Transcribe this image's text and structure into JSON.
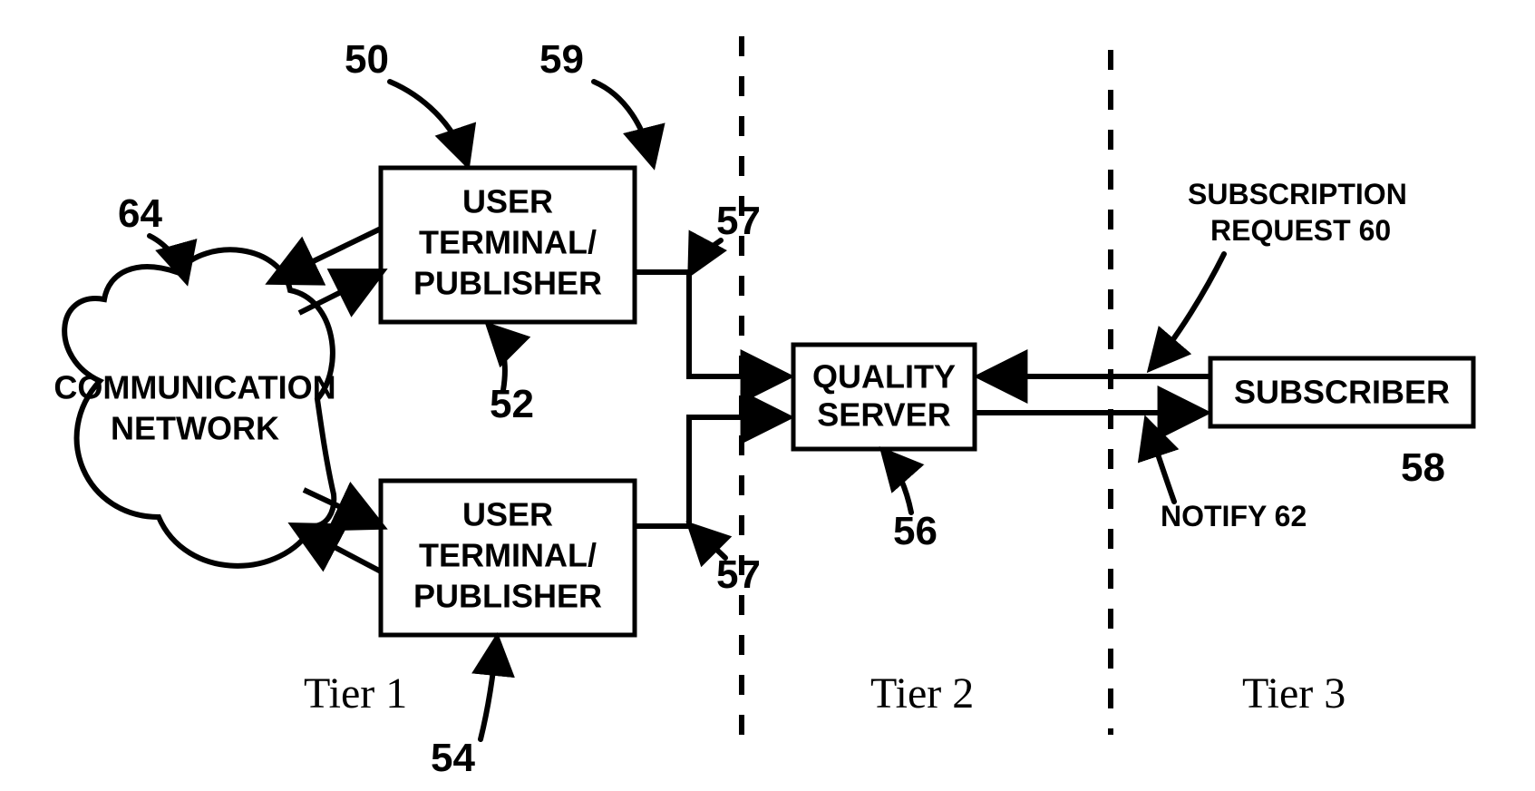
{
  "tiers": {
    "t1": "Tier 1",
    "t2": "Tier 2",
    "t3": "Tier 3"
  },
  "nodes": {
    "network": {
      "line1": "COMMUNICATION",
      "line2": "NETWORK"
    },
    "terminalA": {
      "line1": "USER",
      "line2": "TERMINAL/",
      "line3": "PUBLISHER"
    },
    "terminalB": {
      "line1": "USER",
      "line2": "TERMINAL/",
      "line3": "PUBLISHER"
    },
    "quality": {
      "line1": "QUALITY",
      "line2": "SERVER"
    },
    "subscriber": {
      "line1": "SUBSCRIBER"
    }
  },
  "labels": {
    "subscription": {
      "line1": "SUBSCRIPTION",
      "line2": "REQUEST 60"
    },
    "notify": "NOTIFY 62"
  },
  "refs": {
    "r50": "50",
    "r59": "59",
    "r64": "64",
    "r52": "52",
    "r54": "54",
    "r57a": "57",
    "r57b": "57",
    "r56": "56",
    "r58": "58"
  }
}
